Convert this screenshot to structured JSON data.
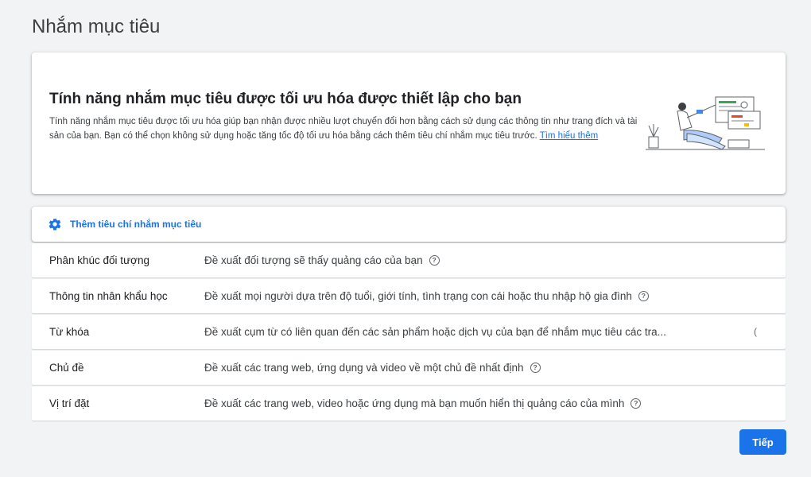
{
  "page": {
    "title": "Nhắm mục tiêu"
  },
  "intro": {
    "heading": "Tính năng nhắm mục tiêu được tối ưu hóa được thiết lập cho bạn",
    "description": "Tính năng nhắm mục tiêu được tối ưu hóa giúp bạn nhận được nhiều lượt chuyển đổi hơn bằng cách sử dụng các thông tin như trang đích và tài sản của bạn. Bạn có thể chọn không sử dụng hoặc tăng tốc độ tối ưu hóa bằng cách thêm tiêu chí nhắm mục tiêu trước.",
    "learn_more": "Tìm hiểu thêm"
  },
  "criteria": {
    "add_label": "Thêm tiêu chí nhắm mục tiêu",
    "rows": [
      {
        "name": "Phân khúc đối tượng",
        "desc": "Đề xuất đối tượng sẽ thấy quảng cáo của bạn"
      },
      {
        "name": "Thông tin nhân khẩu học",
        "desc": "Đề xuất mọi người dựa trên độ tuổi, giới tính, tình trạng con cái hoặc thu nhập hộ gia đình"
      },
      {
        "name": "Từ khóa",
        "desc": "Đề xuất cụm từ có liên quan đến các sản phẩm hoặc dịch vụ của bạn để nhắm mục tiêu các tra..."
      },
      {
        "name": "Chủ đề",
        "desc": "Đề xuất các trang web, ứng dụng và video về một chủ đề nhất định"
      },
      {
        "name": "Vị trí đặt",
        "desc": "Đề xuất các trang web, video hoặc ứng dụng mà bạn muốn hiển thị quảng cáo của mình"
      }
    ]
  },
  "footer": {
    "next_label": "Tiếp"
  },
  "icons": {
    "help": "help-circle-icon",
    "gear": "gear-icon",
    "illustration": "person-with-laptop-illustration"
  },
  "colors": {
    "accent": "#1a73e8",
    "background": "#f1f3f4"
  }
}
